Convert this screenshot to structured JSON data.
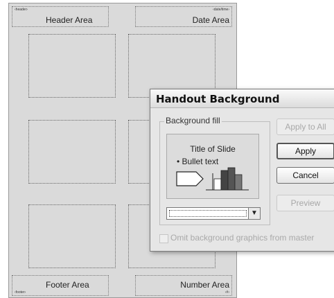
{
  "page": {
    "header_tag": "‹header›",
    "header_label": "Header Area",
    "date_tag": "‹date/time›",
    "date_label": "Date Area",
    "footer_tag": "‹footer›",
    "footer_label": "Footer Area",
    "number_tag": "‹#›",
    "number_label": "Number Area"
  },
  "dialog": {
    "title": "Handout Background",
    "group_label": "Background fill",
    "preview": {
      "slide_title": "Title of Slide",
      "bullet_text": "• Bullet text"
    },
    "buttons": {
      "apply_all": "Apply to All",
      "apply": "Apply",
      "cancel": "Cancel",
      "preview": "Preview"
    },
    "checkbox_label": "Omit background graphics from master"
  }
}
